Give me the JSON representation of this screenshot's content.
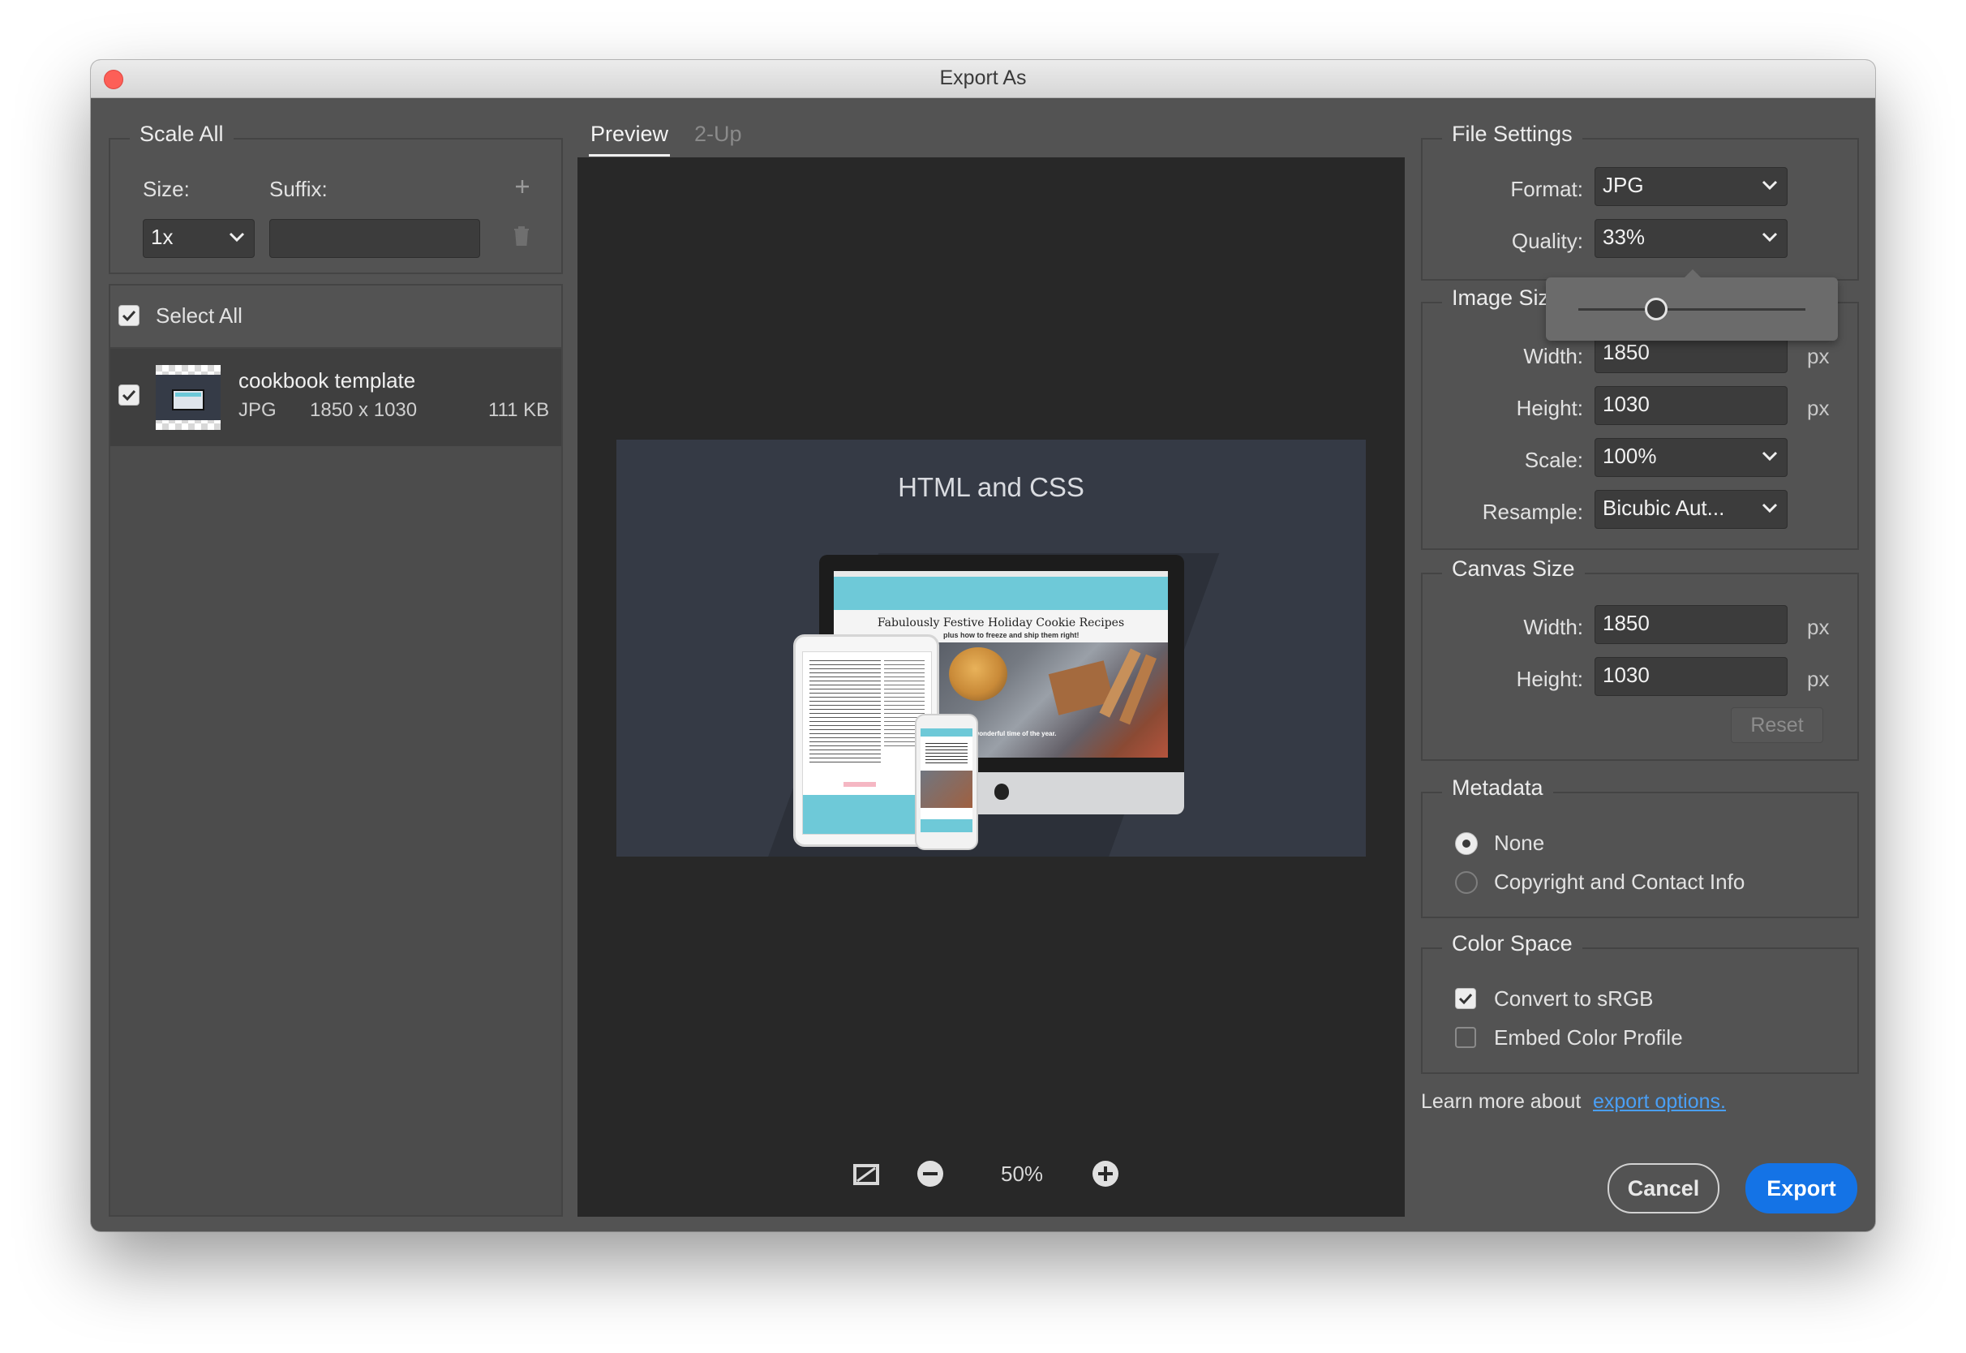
{
  "window": {
    "title": "Export As"
  },
  "scale_all": {
    "legend": "Scale All",
    "size_label": "Size:",
    "suffix_label": "Suffix:",
    "add_icon": "plus-icon",
    "delete_icon": "trash-icon",
    "size_value": "1x",
    "suffix_value": ""
  },
  "assets": {
    "select_all_label": "Select All",
    "select_all_checked": true,
    "items": [
      {
        "name": "cookbook template",
        "format": "JPG",
        "dimensions": "1850 x 1030",
        "filesize": "111 KB",
        "checked": true
      }
    ]
  },
  "preview": {
    "tabs": [
      {
        "label": "Preview",
        "active": true
      },
      {
        "label": "2-Up",
        "active": false
      }
    ],
    "image_heading": "HTML and CSS",
    "site_headline": "Fabulously Festive Holiday Cookie Recipes",
    "site_subheadline": "plus how to freeze and ship them right!",
    "site_caption": "It's the most wonderful time of the year.",
    "zoom_level": "50%",
    "toolbar_icons": [
      "transparency-toggle-icon",
      "zoom-out-icon",
      "zoom-in-icon"
    ]
  },
  "file_settings": {
    "legend": "File Settings",
    "format_label": "Format:",
    "format_value": "JPG",
    "quality_label": "Quality:",
    "quality_value": "33%",
    "quality_slider_level": 0.33
  },
  "image_size": {
    "legend": "Image Size",
    "width_label": "Width:",
    "width_value": "1850",
    "height_label": "Height:",
    "height_value": "1030",
    "scale_label": "Scale:",
    "scale_value": "100%",
    "resample_label": "Resample:",
    "resample_value": "Bicubic Aut...",
    "unit": "px"
  },
  "canvas_size": {
    "legend": "Canvas Size",
    "width_label": "Width:",
    "width_value": "1850",
    "height_label": "Height:",
    "height_value": "1030",
    "unit": "px",
    "reset_label": "Reset"
  },
  "metadata": {
    "legend": "Metadata",
    "options": [
      {
        "label": "None",
        "selected": true
      },
      {
        "label": "Copyright and Contact Info",
        "selected": false
      }
    ]
  },
  "color_space": {
    "legend": "Color Space",
    "options": [
      {
        "label": "Convert to sRGB",
        "checked": true
      },
      {
        "label": "Embed Color Profile",
        "checked": false
      }
    ]
  },
  "footer": {
    "learn_more_text": "Learn more about",
    "learn_more_link": "export options.",
    "cancel_label": "Cancel",
    "export_label": "Export"
  },
  "colors": {
    "accent": "#1473e6",
    "link": "#4a9ff5",
    "panel": "#535353",
    "preview_bg": "#282828"
  }
}
